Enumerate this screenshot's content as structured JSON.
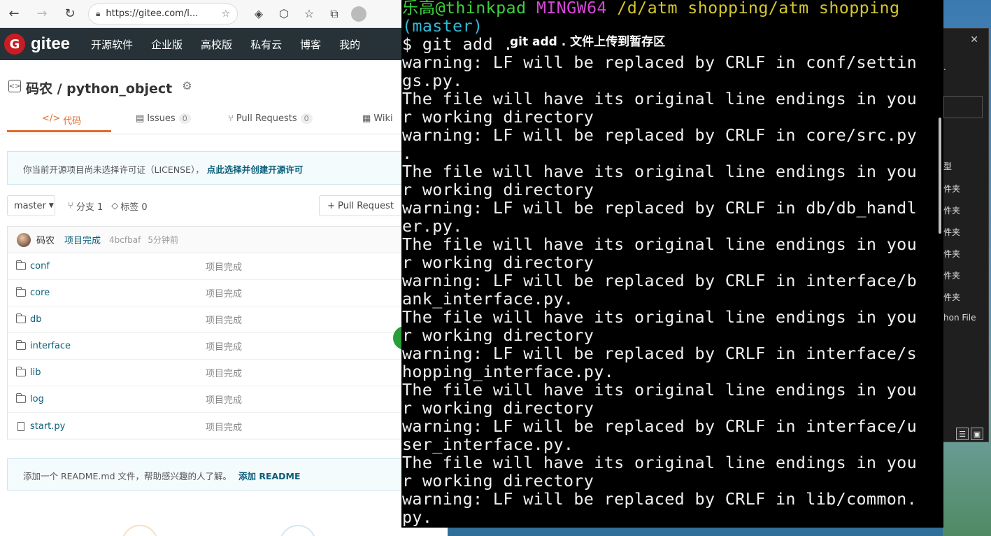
{
  "browser": {
    "url": "https://gitee.com/l...",
    "avatar_alt": ""
  },
  "gitee": {
    "logo_letter": "G",
    "logo_text": "gitee",
    "nav_links": [
      "开源软件",
      "企业版",
      "高校版",
      "私有云",
      "博客",
      "我的"
    ]
  },
  "repo": {
    "title": "码农 / python_object",
    "tabs": [
      {
        "icon": "</>",
        "label": "代码",
        "badge": ""
      },
      {
        "icon": "▤",
        "label": "Issues",
        "badge": "0"
      },
      {
        "icon": "⑂",
        "label": "Pull Requests",
        "badge": "0"
      },
      {
        "icon": "▦",
        "label": "Wiki",
        "badge": ""
      }
    ],
    "license_notice": "你当前开源项目尚未选择许可证（LICENSE），",
    "license_link": "点此选择并创建开源许可",
    "branch": "master",
    "branch_count": "分支 1",
    "tag_count": "标签 0",
    "pull_request_btn": "+ Pull Request",
    "commit": {
      "author": "码农",
      "message": "项目完成",
      "hash": "4bcfbaf",
      "time": "5分钟前"
    },
    "files": [
      {
        "name": "conf",
        "type": "folder",
        "message": "项目完成"
      },
      {
        "name": "core",
        "type": "folder",
        "message": "项目完成"
      },
      {
        "name": "db",
        "type": "folder",
        "message": "项目完成"
      },
      {
        "name": "interface",
        "type": "folder",
        "message": "项目完成"
      },
      {
        "name": "lib",
        "type": "folder",
        "message": "项目完成"
      },
      {
        "name": "log",
        "type": "folder",
        "message": "项目完成"
      },
      {
        "name": "start.py",
        "type": "file",
        "message": "项目完成"
      }
    ],
    "readme_notice": "添加一个 README.md 文件，帮助感兴趣的人了解。",
    "readme_link": "添加 README"
  },
  "terminal": {
    "prompt_user": "乐高@thinkpad",
    "prompt_env": "MINGW64",
    "prompt_path": "/d/atm shopping/atm shopping",
    "prompt_branch": "(master)",
    "command": "$ git add .",
    "annotation": "git add . 文件上传到暂存区",
    "output_lines": [
      "warning: LF will be replaced by CRLF in conf/settin",
      "gs.py.",
      "The file will have its original line endings in you",
      "r working directory",
      "warning: LF will be replaced by CRLF in core/src.py",
      ".",
      "The file will have its original line endings in you",
      "r working directory",
      "warning: LF will be replaced by CRLF in db/db_handl",
      "er.py.",
      "The file will have its original line endings in you",
      "r working directory",
      "warning: LF will be replaced by CRLF in interface/b",
      "ank_interface.py.",
      "The file will have its original line endings in you",
      "r working directory",
      "warning: LF will be replaced by CRLF in interface/s",
      "hopping_interface.py.",
      "The file will have its original line endings in you",
      "r working directory",
      "warning: LF will be replaced by CRLF in interface/u",
      "ser_interface.py.",
      "The file will have its original line endings in you",
      "r working directory",
      "warning: LF will be replaced by CRLF in lib/common.",
      "py."
    ]
  },
  "explorer": {
    "items": [
      "型",
      "件夹",
      "件夹",
      "件夹",
      "件夹",
      "件夹",
      "件夹",
      "hon File"
    ]
  },
  "colors": {
    "terminal_bg": "#000000",
    "prompt_green": "#3cd03c",
    "prompt_magenta": "#d946d9",
    "prompt_yellow": "#d4c72c",
    "prompt_cyan": "#31b9d6",
    "gitee_nav": "#263238",
    "gitee_red": "#c71d23",
    "accent_orange": "#e06b2e"
  }
}
